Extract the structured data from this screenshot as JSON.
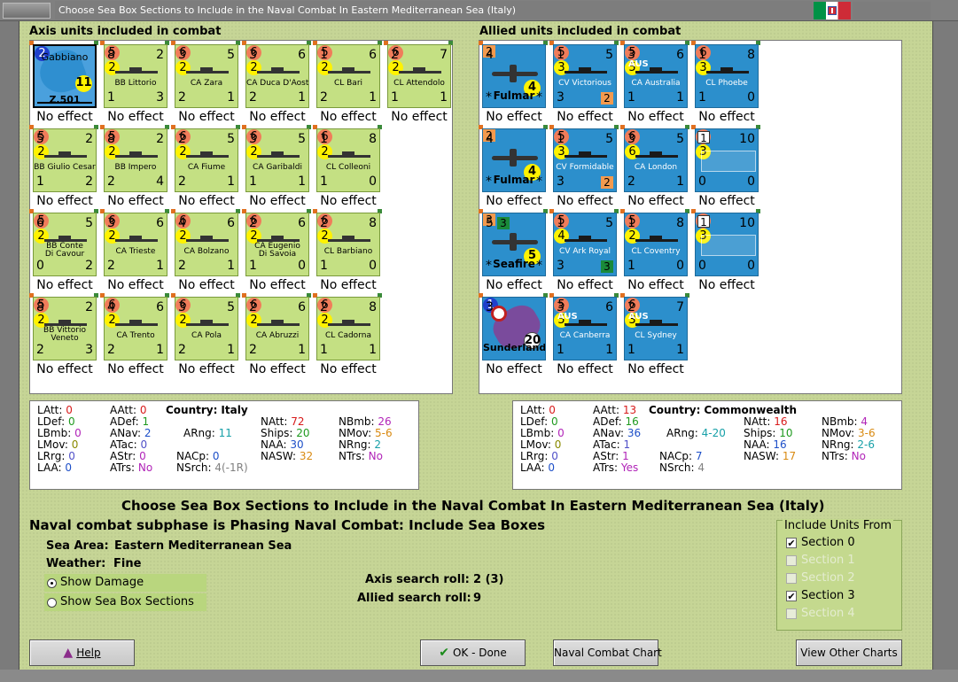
{
  "window": {
    "title": "Choose Sea Box Sections to Include in the Naval Combat In Eastern Mediterranean Sea (Italy)"
  },
  "axis": {
    "header": "Axis units included in combat",
    "units": [
      {
        "name": "Gabbiano",
        "tl": "",
        "tr": "",
        "tc": "2",
        "bl": "",
        "bc": "",
        "br": "",
        "label": "Z.501",
        "extra": "11",
        "effect": "No effect",
        "kind": "seaplane",
        "row": 0,
        "col": 0
      },
      {
        "name": "BB Littorio",
        "tl": "8",
        "tr": "2",
        "tc": "5",
        "bl": "1",
        "bc": "2",
        "br": "3",
        "effect": "No effect",
        "kind": "ship",
        "row": 0,
        "col": 1
      },
      {
        "name": "CA Zara",
        "tl": "3",
        "tr": "5",
        "tc": "6",
        "bl": "2",
        "bc": "2",
        "br": "1",
        "effect": "No effect",
        "kind": "ship",
        "row": 0,
        "col": 2
      },
      {
        "name": "CA Duca D'Aosta",
        "tl": "3",
        "tr": "6",
        "tc": "6",
        "bl": "2",
        "bc": "2",
        "br": "1",
        "effect": "No effect",
        "kind": "ship",
        "row": 0,
        "col": 3
      },
      {
        "name": "CL Bari",
        "tl": "1",
        "tr": "6",
        "tc": "5",
        "bl": "2",
        "bc": "2",
        "br": "1",
        "effect": "No effect",
        "kind": "ship",
        "row": 0,
        "col": 4
      },
      {
        "name": "CL Attendolo",
        "tl": "2",
        "tr": "7",
        "tc": "6",
        "bl": "1",
        "bc": "2",
        "br": "1",
        "effect": "No effect",
        "kind": "ship",
        "row": 0,
        "col": 5
      },
      {
        "name": "BB Giulio Cesar",
        "tl": "5",
        "tr": "2",
        "tc": "5",
        "bl": "1",
        "bc": "2",
        "br": "2",
        "effect": "No effect",
        "kind": "ship",
        "row": 1,
        "col": 0
      },
      {
        "name": "BB Impero",
        "tl": "8",
        "tr": "2",
        "tc": "5",
        "bl": "2",
        "bc": "2",
        "br": "4",
        "effect": "No effect",
        "kind": "ship",
        "row": 1,
        "col": 1
      },
      {
        "name": "CA Fiume",
        "tl": "2",
        "tr": "5",
        "tc": "6",
        "bl": "2",
        "bc": "2",
        "br": "1",
        "effect": "No effect",
        "kind": "ship",
        "row": 1,
        "col": 2
      },
      {
        "name": "CA Garibaldi",
        "tl": "3",
        "tr": "5",
        "tc": "6",
        "bl": "1",
        "bc": "2",
        "br": "1",
        "effect": "No effect",
        "kind": "ship",
        "row": 1,
        "col": 3
      },
      {
        "name": "CL Colleoni",
        "tl": "1",
        "tr": "8",
        "tc": "6",
        "bl": "1",
        "bc": "2",
        "br": "0",
        "effect": "No effect",
        "kind": "ship",
        "row": 1,
        "col": 4
      },
      {
        "name": "BB Conte\nDi Cavour",
        "tl": "6",
        "tr": "5",
        "tc": "5",
        "bl": "0",
        "bc": "2",
        "br": "2",
        "effect": "No effect",
        "kind": "ship",
        "row": 2,
        "col": 0
      },
      {
        "name": "CA Trieste",
        "tl": "3",
        "tr": "6",
        "tc": "6",
        "bl": "2",
        "bc": "2",
        "br": "1",
        "effect": "No effect",
        "kind": "ship",
        "row": 2,
        "col": 1
      },
      {
        "name": "CA Bolzano",
        "tl": "4",
        "tr": "6",
        "tc": "6",
        "bl": "2",
        "bc": "2",
        "br": "1",
        "effect": "No effect",
        "kind": "ship",
        "row": 2,
        "col": 2
      },
      {
        "name": "CA Eugenio\nDi Savoia",
        "tl": "2",
        "tr": "6",
        "tc": "6",
        "bl": "1",
        "bc": "2",
        "br": "0",
        "effect": "No effect",
        "kind": "ship",
        "row": 2,
        "col": 3
      },
      {
        "name": "CL Barbiano",
        "tl": "2",
        "tr": "8",
        "tc": "6",
        "bl": "1",
        "bc": "2",
        "br": "0",
        "effect": "No effect",
        "kind": "ship",
        "row": 2,
        "col": 4
      },
      {
        "name": "BB Vittorio\nVeneto",
        "tl": "8",
        "tr": "2",
        "tc": "5",
        "bl": "2",
        "bc": "2",
        "br": "3",
        "effect": "No effect",
        "kind": "ship",
        "row": 3,
        "col": 0
      },
      {
        "name": "CA Trento",
        "tl": "4",
        "tr": "6",
        "tc": "6",
        "bl": "2",
        "bc": "2",
        "br": "1",
        "effect": "No effect",
        "kind": "ship",
        "row": 3,
        "col": 1
      },
      {
        "name": "CA Pola",
        "tl": "3",
        "tr": "5",
        "tc": "6",
        "bl": "2",
        "bc": "2",
        "br": "1",
        "effect": "No effect",
        "kind": "ship",
        "row": 3,
        "col": 2
      },
      {
        "name": "CA Abruzzi",
        "tl": "2",
        "tr": "6",
        "tc": "6",
        "bl": "2",
        "bc": "2",
        "br": "1",
        "effect": "No effect",
        "kind": "ship",
        "row": 3,
        "col": 3
      },
      {
        "name": "CL Cadorna",
        "tl": "2",
        "tr": "8",
        "tc": "6",
        "bl": "1",
        "bc": "2",
        "br": "1",
        "effect": "No effect",
        "kind": "ship",
        "row": 3,
        "col": 4
      }
    ]
  },
  "allied": {
    "header": "Allied units included in combat",
    "units": [
      {
        "name": "Fulmar",
        "tl": "4",
        "tr": "2",
        "tc": "2",
        "bl": "*",
        "bc": "4",
        "br": "*",
        "effect": "No effect",
        "kind": "plane",
        "row": 0,
        "col": 0
      },
      {
        "name": "CV Victorious",
        "tl": "1",
        "tr": "5",
        "tc": "5",
        "bl": "3",
        "bc": "3",
        "br": "2",
        "effect": "No effect",
        "kind": "ship",
        "row": 0,
        "col": 1
      },
      {
        "name": "CA Australia",
        "nat": "AUS",
        "tl": "3",
        "tr": "6",
        "tc": "5",
        "bl": "1",
        "bc": "5",
        "br": "1",
        "effect": "No effect",
        "kind": "ship",
        "row": 0,
        "col": 2
      },
      {
        "name": "CL Phoebe",
        "tl": "1",
        "tr": "8",
        "tc": "6",
        "bl": "1",
        "bc": "3",
        "br": "0",
        "effect": "No effect",
        "kind": "ship",
        "row": 0,
        "col": 3
      },
      {
        "name": "Fulmar",
        "tl": "4",
        "tr": "2",
        "tc": "2",
        "bl": "*",
        "bc": "4",
        "br": "*",
        "effect": "No effect",
        "kind": "plane",
        "row": 1,
        "col": 0
      },
      {
        "name": "CV Formidable",
        "tl": "1",
        "tr": "5",
        "tc": "5",
        "bl": "3",
        "bc": "3",
        "br": "2",
        "effect": "No effect",
        "kind": "ship",
        "row": 1,
        "col": 1
      },
      {
        "name": "CA London",
        "tl": "3",
        "tr": "5",
        "tc": "6",
        "bl": "2",
        "bc": "6",
        "br": "1",
        "effect": "No effect",
        "kind": "ship",
        "row": 1,
        "col": 2
      },
      {
        "name": "",
        "tl": "1",
        "tr": "10",
        "tc": "3",
        "bl": "0",
        "bc": "3",
        "br": "0",
        "effect": "No effect",
        "kind": "ghost",
        "row": 1,
        "col": 3
      },
      {
        "name": "Seafire",
        "tl": "5",
        "tr": "3",
        "tc": "3",
        "bl": "*",
        "bc": "5",
        "br": "*",
        "effect": "No effect",
        "kind": "plane",
        "row": 2,
        "col": 0
      },
      {
        "name": "CV Ark Royal",
        "tl": "1",
        "tr": "5",
        "tc": "5",
        "bl": "3",
        "bc": "4",
        "br": "3",
        "effect": "No effect",
        "kind": "ship",
        "row": 2,
        "col": 1
      },
      {
        "name": "CL Coventry",
        "tl": "1",
        "tr": "8",
        "tc": "5",
        "bl": "1",
        "bc": "2",
        "br": "0",
        "effect": "No effect",
        "kind": "ship",
        "row": 2,
        "col": 2
      },
      {
        "name": "",
        "tl": "1",
        "tr": "10",
        "tc": "3",
        "bl": "0",
        "bc": "3",
        "br": "0",
        "effect": "No effect",
        "kind": "ghost",
        "row": 2,
        "col": 3
      },
      {
        "name": "Sunderland",
        "tl": "3",
        "tr": "",
        "tc": "1",
        "bl": "",
        "bc": "20",
        "br": "",
        "effect": "No effect",
        "kind": "sunderland",
        "row": 3,
        "col": 0
      },
      {
        "name": "CA Canberra",
        "nat": "AUS",
        "tl": "3",
        "tr": "6",
        "tc": "5",
        "bl": "1",
        "bc": "5",
        "br": "1",
        "effect": "No effect",
        "kind": "ship",
        "row": 3,
        "col": 1
      },
      {
        "name": "CL Sydney",
        "nat": "AUS",
        "tl": "2",
        "tr": "7",
        "tc": "6",
        "bl": "1",
        "bc": "3",
        "br": "1",
        "effect": "No effect",
        "kind": "ship",
        "row": 3,
        "col": 2
      }
    ]
  },
  "axis_stats": {
    "country_label": "Country:",
    "country": "Italy",
    "LAtt": "0",
    "LDef": "0",
    "LBmb": "0",
    "LMov": "0",
    "LRrg": "0",
    "LAA": "0",
    "AAtt": "0",
    "ADef": "1",
    "ANav": "2",
    "ATac": "0",
    "AStr": "0",
    "ATrs": "No",
    "ARng": "11",
    "NACp": "0",
    "NSrch": "4(-1R)",
    "NAtt": "72",
    "Ships": "20",
    "NAA": "30",
    "NASW": "32",
    "NBmb": "26",
    "NMov": "5-6",
    "NRng": "2",
    "NTrs": "No"
  },
  "allied_stats": {
    "country_label": "Country:",
    "country": "Commonwealth",
    "LAtt": "0",
    "LDef": "0",
    "LBmb": "0",
    "LMov": "0",
    "LRrg": "0",
    "LAA": "0",
    "AAtt": "13",
    "ADef": "16",
    "ANav": "36",
    "ATac": "1",
    "AStr": "1",
    "ATrs": "Yes",
    "ARng": "4-20",
    "NACp": "7",
    "NSrch": "4",
    "NAtt": "16",
    "Ships": "10",
    "NAA": "16",
    "NASW": "17",
    "NBmb": "4",
    "NMov": "3-6",
    "NRng": "2-6",
    "NTrs": "No"
  },
  "main": {
    "heading": "Choose Sea Box Sections to Include in the Naval Combat In Eastern Mediterranean Sea (Italy)",
    "subphase": "Naval combat subphase is Phasing Naval Combat: Include Sea Boxes",
    "sea_area_label": "Sea Area:",
    "sea_area": "Eastern Mediterranean Sea",
    "weather_label": "Weather:",
    "weather": "Fine",
    "show_damage": "Show Damage",
    "show_sections": "Show Sea Box Sections",
    "axis_roll_label": "Axis search roll:",
    "axis_roll": "2 (3)",
    "allied_roll_label": "Allied search roll:",
    "allied_roll": "9"
  },
  "include": {
    "title": "Include Units From",
    "sections": [
      {
        "label": "Section 0",
        "checked": true,
        "enabled": true
      },
      {
        "label": "Section 1",
        "checked": false,
        "enabled": false
      },
      {
        "label": "Section 2",
        "checked": false,
        "enabled": false
      },
      {
        "label": "Section 3",
        "checked": true,
        "enabled": true
      },
      {
        "label": "Section 4",
        "checked": false,
        "enabled": false
      }
    ]
  },
  "buttons": {
    "help": "Help",
    "ok": "OK - Done",
    "chart": "Naval Combat Chart",
    "other": "View Other Charts"
  },
  "colors": {
    "axis_counter": "#c4e083",
    "allied_counter": "#2c8fcc",
    "background": "#c6d596",
    "attack_circle": "#f07c5a",
    "value_circle": "#fff200"
  }
}
